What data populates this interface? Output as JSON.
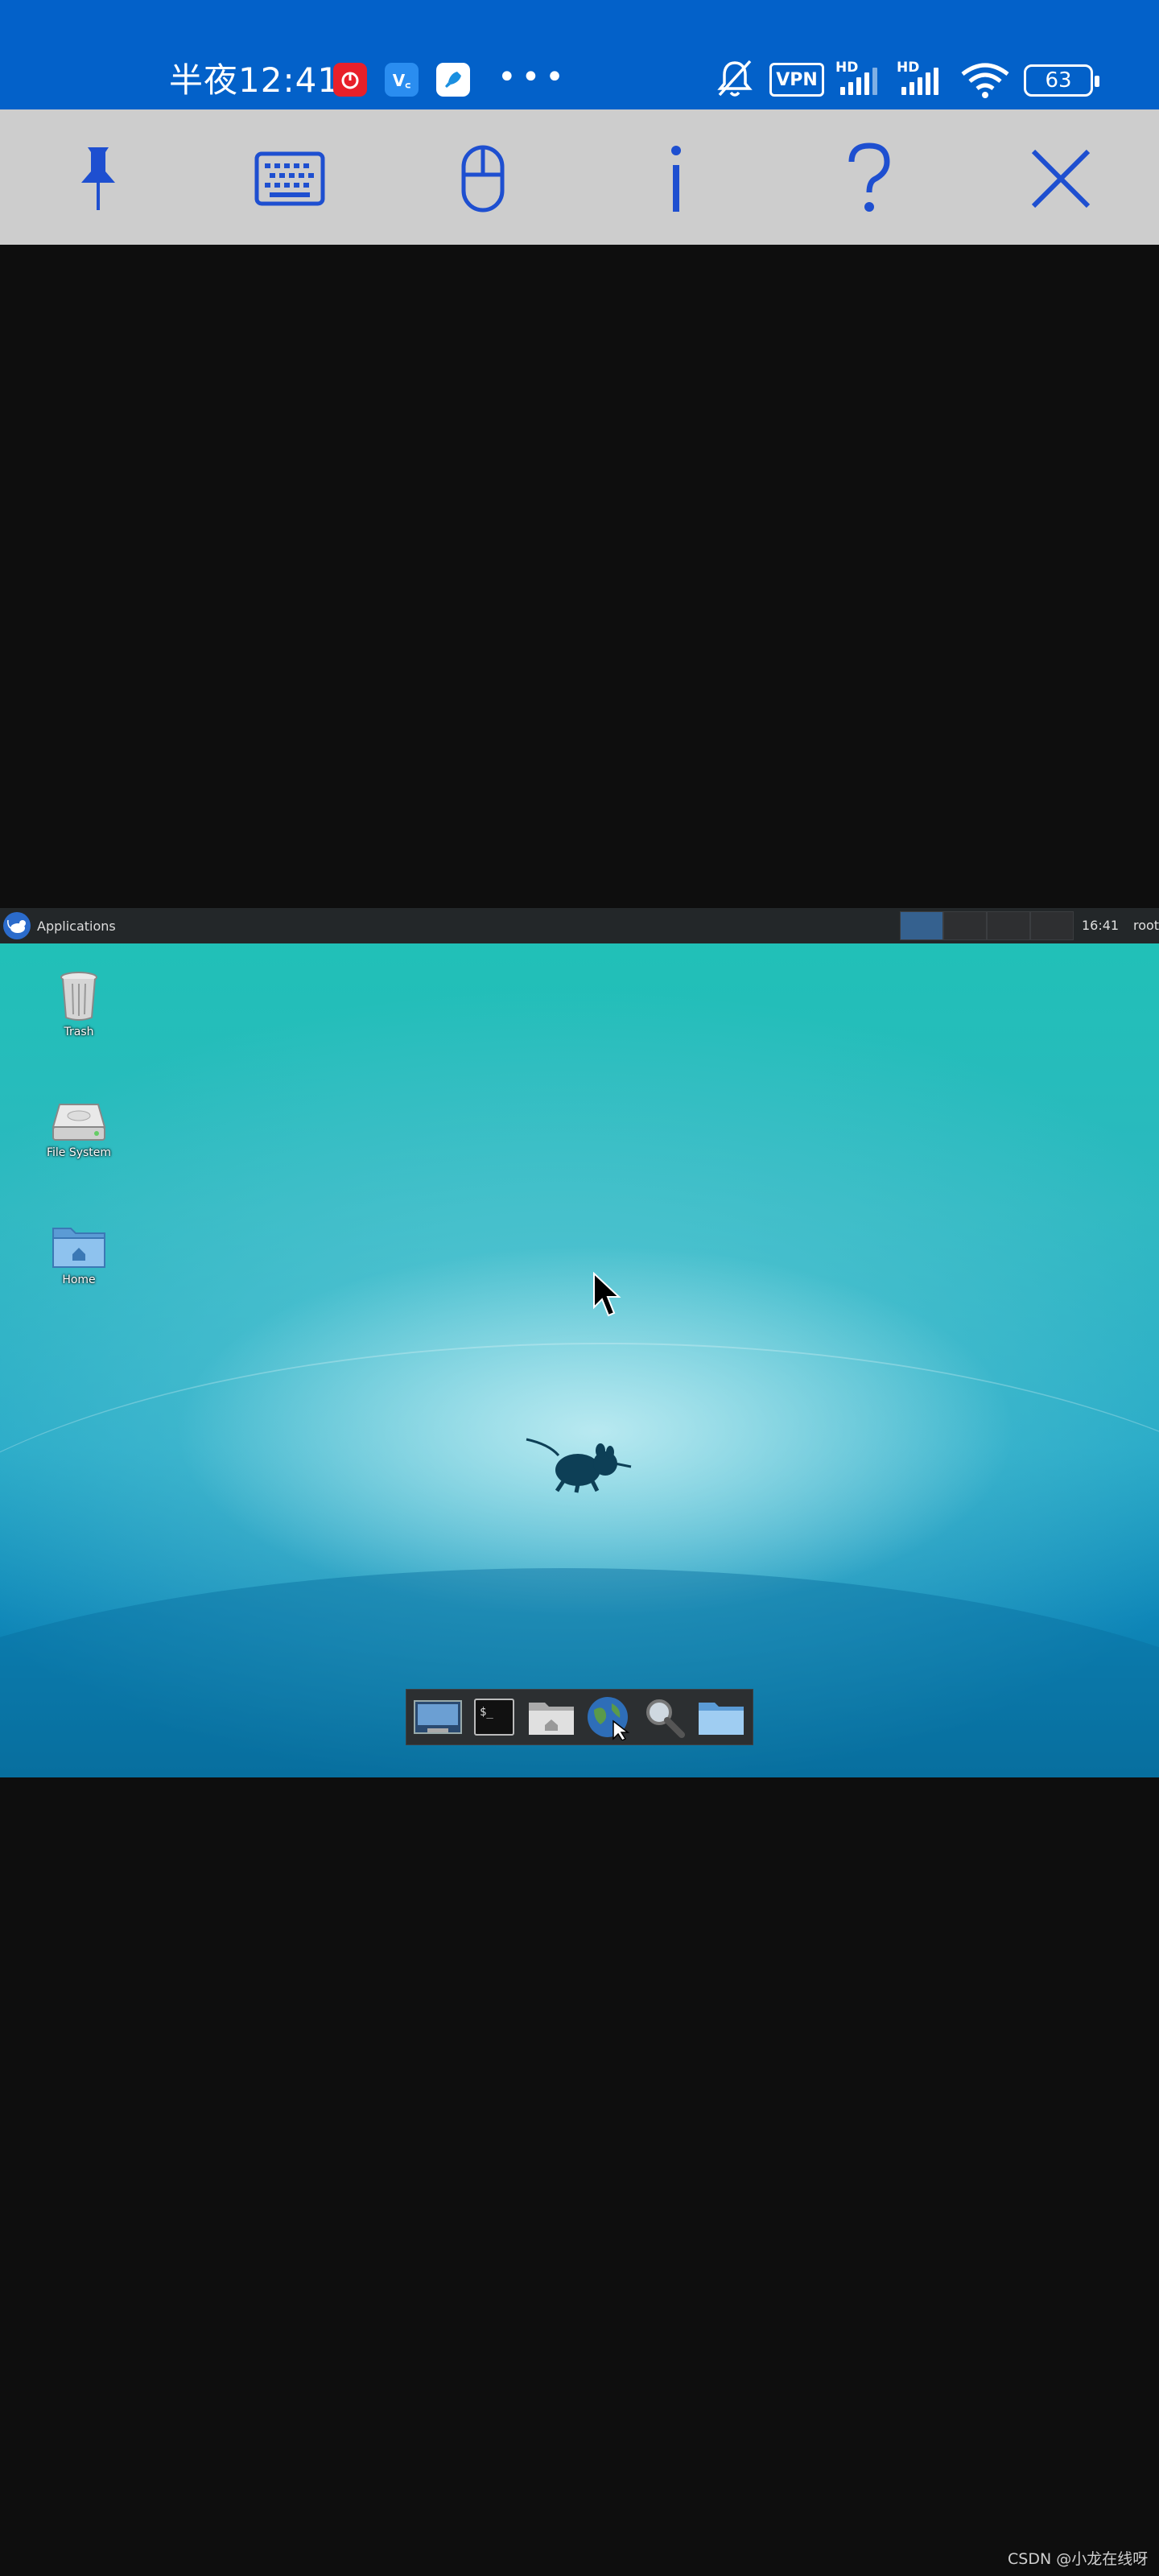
{
  "status_bar": {
    "time": "半夜12:41",
    "more": "•••",
    "vpn": "VPN",
    "hd1": "HD",
    "hd2": "HD",
    "battery": "63",
    "notification_colors": [
      "#e8202a",
      "#2a8df0",
      "#ffffff"
    ]
  },
  "toolbar": {
    "buttons": [
      "pin-icon",
      "keyboard-icon",
      "mouse-icon",
      "info-icon",
      "help-icon",
      "close-icon"
    ],
    "accent": "#1e4fd0"
  },
  "desktop": {
    "panel": {
      "applications_label": "Applications",
      "workspaces": 4,
      "active_workspace": 1,
      "clock": "16:41",
      "user": "root"
    },
    "icons": [
      {
        "label": "Trash"
      },
      {
        "label": "File System"
      },
      {
        "label": "Home"
      }
    ],
    "dock": [
      "show-desktop-icon",
      "terminal-icon",
      "home-folder-icon",
      "web-browser-icon",
      "search-icon",
      "folder-icon"
    ]
  },
  "watermark": "CSDN @小龙在线呀"
}
